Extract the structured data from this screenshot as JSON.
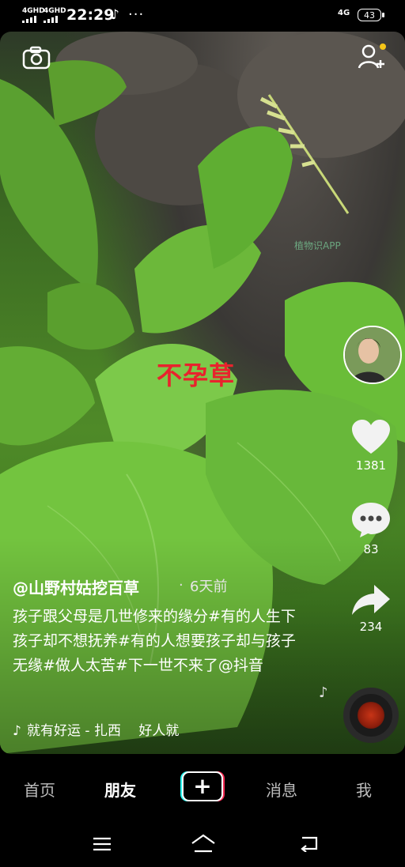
{
  "status_bar": {
    "signal1": "4GHD",
    "signal2": "4GHD",
    "time": "22:29",
    "more": "···",
    "network": "4G",
    "battery": "43"
  },
  "video": {
    "watermark": "植物识APP",
    "overlay_label": "不孕草"
  },
  "actions": {
    "likes": "1381",
    "comments": "83",
    "shares": "234"
  },
  "post": {
    "author": "@山野村姑挖百草",
    "separator": "·",
    "date": "6天前",
    "caption": "孩子跟父母是几世修来的缘分#有的人生下孩子却不想抚养#有的人想要孩子却与孩子无缘#做人太苦#下一世不来了@抖音",
    "music": "就有好运 - 扎西　 好人就"
  },
  "tabs": {
    "home": "首页",
    "friends": "朋友",
    "create": "+",
    "messages": "消息",
    "me": "我"
  }
}
